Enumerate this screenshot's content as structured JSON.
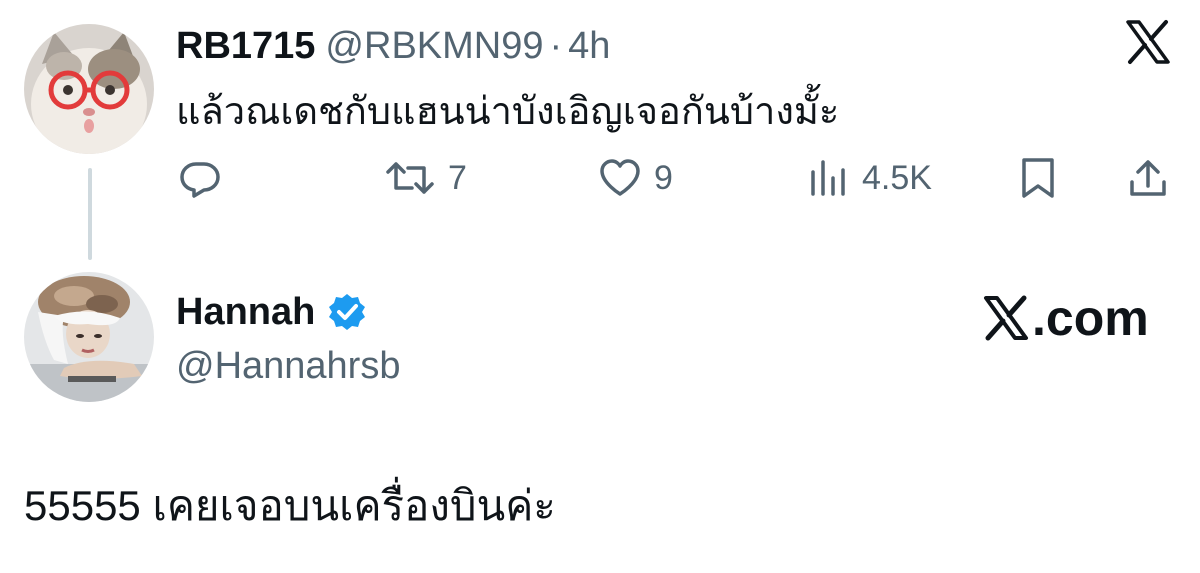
{
  "parent_tweet": {
    "display_name": "RB1715",
    "handle": "@RBKMN99",
    "separator": "·",
    "time": "4h",
    "text": "แล้วณเดชกับแฮนน่าบังเอิญเจอกันบ้างมั้ะ",
    "retweets": "7",
    "likes": "9",
    "views": "4.5K"
  },
  "reply_tweet": {
    "display_name": "Hannah",
    "handle": "@Hannahrsb",
    "text": "55555 เคยเจอบนเครื่องบินค่ะ"
  },
  "watermark": {
    "label": ".com"
  },
  "colors": {
    "text_primary": "#0f1419",
    "text_secondary": "#536471",
    "verified_blue": "#1d9bf0",
    "thread_line": "#cfd9de"
  },
  "icons": [
    "reply-icon",
    "retweet-icon",
    "like-icon",
    "views-icon",
    "bookmark-icon",
    "share-icon",
    "x-logo-icon",
    "verified-badge-icon"
  ]
}
